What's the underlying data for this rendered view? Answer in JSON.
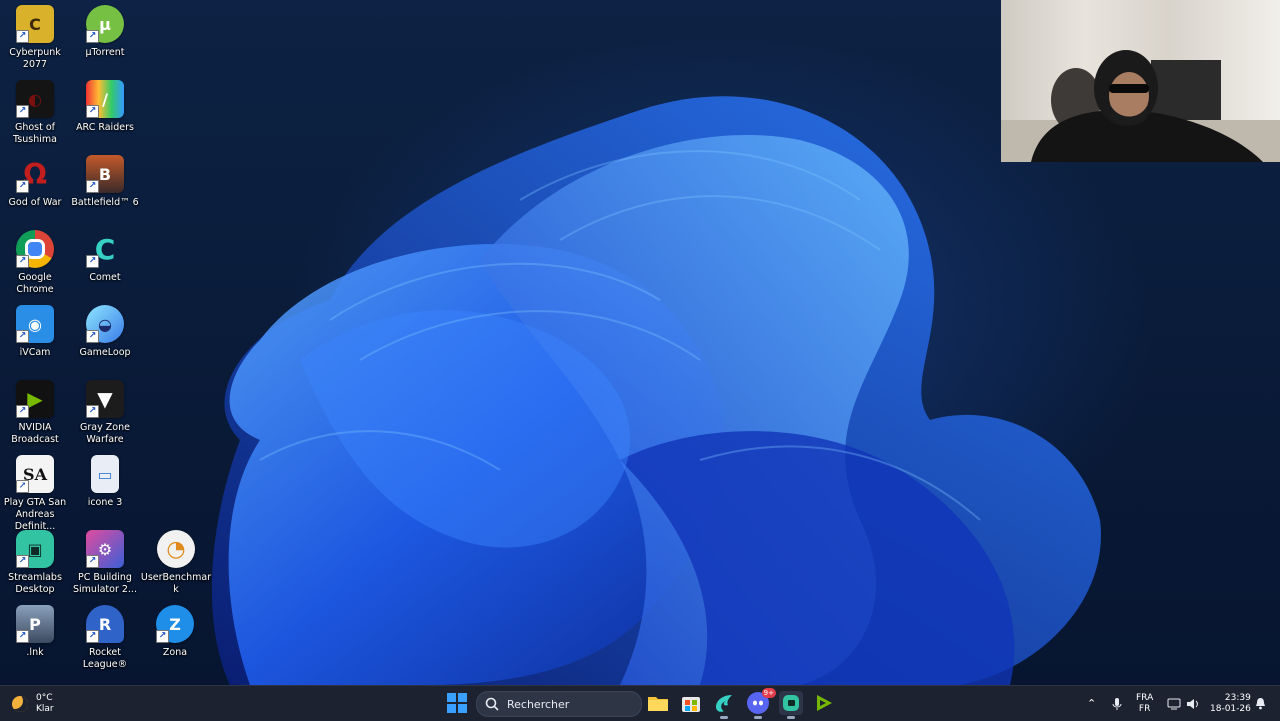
{
  "desktop": {
    "icons": [
      {
        "label": "Cyberpunk 2077",
        "icon": "cyberpunk-icon",
        "color": "#d9b12a",
        "glyph": "C"
      },
      {
        "label": "µTorrent",
        "icon": "utorrent-icon",
        "color": "#76c043",
        "glyph": "µ"
      },
      {
        "label": "Ghost of Tsushima",
        "icon": "ghost-of-tsushima-icon",
        "color": "#1a1a1a",
        "glyph": "◐"
      },
      {
        "label": "ARC Raiders",
        "icon": "arc-raiders-icon",
        "color": "#2b2b2b",
        "glyph": "/"
      },
      {
        "label": "God of War",
        "icon": "god-of-war-icon",
        "color": "#b02020",
        "glyph": "Ω"
      },
      {
        "label": "Battlefield™ 6",
        "icon": "battlefield-icon",
        "color": "#5a3a2a",
        "glyph": "B"
      },
      {
        "label": "Google Chrome",
        "icon": "chrome-icon",
        "color": "#db4437",
        "glyph": "●"
      },
      {
        "label": "Comet",
        "icon": "comet-icon",
        "color": "#1b3a44",
        "glyph": "C"
      },
      {
        "label": "iVCam",
        "icon": "ivcam-icon",
        "color": "#2a8ee6",
        "glyph": "◉"
      },
      {
        "label": "GameLoop",
        "icon": "gameloop-icon",
        "color": "#3aa0e8",
        "glyph": "◒"
      },
      {
        "label": "NVIDIA Broadcast",
        "icon": "nvidia-broadcast-icon",
        "color": "#1a1a1a",
        "glyph": "▶"
      },
      {
        "label": "Gray Zone Warfare",
        "icon": "gray-zone-warfare-icon",
        "color": "#222222",
        "glyph": "▼"
      },
      {
        "label": "Play GTA San Andreas Definit...",
        "icon": "gta-san-andreas-icon",
        "color": "#f4f4f4",
        "glyph": "SA"
      },
      {
        "label": "icone 3",
        "icon": "file-icon",
        "color": "#e9eef6",
        "glyph": "▭"
      },
      {
        "label": "Streamlabs Desktop",
        "icon": "streamlabs-icon",
        "color": "#31c3a2",
        "glyph": "▣"
      },
      {
        "label": "PC Building Simulator 2...",
        "icon": "pc-building-simulator-icon",
        "color": "#3a5fd8",
        "glyph": "⚙"
      },
      {
        "label": "UserBenchmark",
        "icon": "userbenchmark-icon",
        "color": "#f1f1f1",
        "glyph": "◔"
      },
      {
        "label": ".lnk",
        "icon": "pubg-icon",
        "color": "#4a5a70",
        "glyph": "P"
      },
      {
        "label": "Rocket League®",
        "icon": "rocket-league-icon",
        "color": "#2f63c8",
        "glyph": "R"
      },
      {
        "label": "Zona",
        "icon": "zona-icon",
        "color": "#1f8ee8",
        "glyph": "Z"
      }
    ],
    "shortcut_arrow": "↗"
  },
  "taskbar": {
    "weather": {
      "temp": "0°C",
      "condition": "Klar",
      "icon": "moon-weather-icon"
    },
    "search_placeholder": "Rechercher",
    "apps": [
      {
        "name": "start-button",
        "icon": "windows-logo-icon",
        "color": "#3aa0ff"
      },
      {
        "name": "file-explorer",
        "icon": "folder-icon",
        "color": "#f2c23a"
      },
      {
        "name": "microsoft-store",
        "icon": "store-icon",
        "color": "#e8e8e8"
      },
      {
        "name": "comet-browser",
        "icon": "comet-icon",
        "color": "#1b7f8a"
      },
      {
        "name": "discord",
        "icon": "discord-icon",
        "color": "#5865f2",
        "badge": "9+"
      },
      {
        "name": "streamlabs",
        "icon": "streamlabs-icon",
        "color": "#31c3a2"
      },
      {
        "name": "nvidia",
        "icon": "nvidia-icon",
        "color": "#76b900"
      }
    ],
    "language": {
      "line1": "FRA",
      "line2": "FR"
    },
    "clock": {
      "time": "23:39",
      "date": "18-01-26"
    }
  }
}
